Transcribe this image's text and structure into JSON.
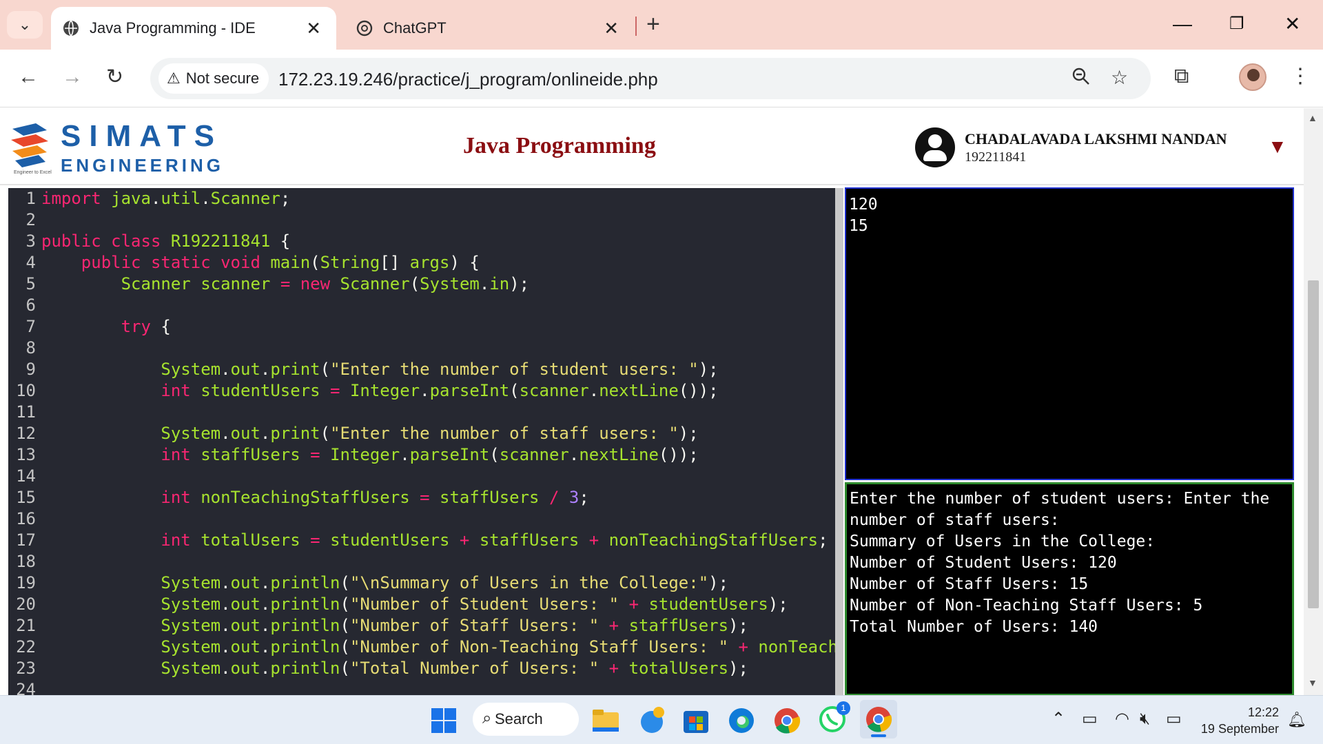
{
  "browser": {
    "tabs": [
      {
        "title": "Java Programming - IDE",
        "active": true
      },
      {
        "title": "ChatGPT",
        "active": false
      }
    ],
    "new_tab_glyph": "+",
    "security_label": "Not secure",
    "url": "172.23.19.246/practice/j_program/onlineide.php"
  },
  "header": {
    "brand_top": "SIMATS",
    "brand_bottom": "ENGINEERING",
    "tagline": "Engineer to Excel",
    "title": "Java Programming",
    "user_name": "CHADALAVADA LAKSHMI NANDAN",
    "user_id": "192211841"
  },
  "editor": {
    "line_numbers": [
      "1",
      "2",
      "3",
      "4",
      "5",
      "6",
      "7",
      "8",
      "9",
      "10",
      "11",
      "12",
      "13",
      "14",
      "15",
      "16",
      "17",
      "18",
      "19",
      "20",
      "21",
      "22",
      "23",
      "24"
    ]
  },
  "stdin": {
    "lines": [
      "120",
      "15"
    ]
  },
  "stdout": {
    "lines": [
      "Enter the number of student users: Enter the number of staff users:",
      "Summary of Users in the College:",
      "Number of Student Users: 120",
      "Number of Staff Users: 15",
      "Number of Non-Teaching Staff Users: 5",
      "Total Number of Users: 140"
    ]
  },
  "taskbar": {
    "search_label": "Search",
    "time": "12:22",
    "date": "19 September",
    "whatsapp_badge": "1"
  },
  "colors": {
    "tab_bar": "#f8d7cf",
    "editor_bg": "#262831",
    "title_red": "#8b0e12",
    "brand_blue": "#1d5fa8",
    "stdin_border": "#1f2fd0",
    "stdout_border": "#2e8b2e"
  },
  "icons": [
    "tab-search-icon",
    "globe-icon",
    "chatgpt-icon",
    "close-icon",
    "new-tab-icon",
    "minimize-icon",
    "restore-icon",
    "back-icon",
    "forward-icon",
    "reload-icon",
    "warning-icon",
    "zoom-icon",
    "star-icon",
    "extensions-icon",
    "menu-icon",
    "user-icon",
    "dropdown-icon",
    "windows-start-icon",
    "search-icon",
    "file-explorer-icon",
    "copilot-icon",
    "store-icon",
    "edge-icon",
    "chrome-icon",
    "whatsapp-icon",
    "wifi-icon",
    "volume-muted-icon",
    "battery-icon",
    "bell-icon"
  ]
}
